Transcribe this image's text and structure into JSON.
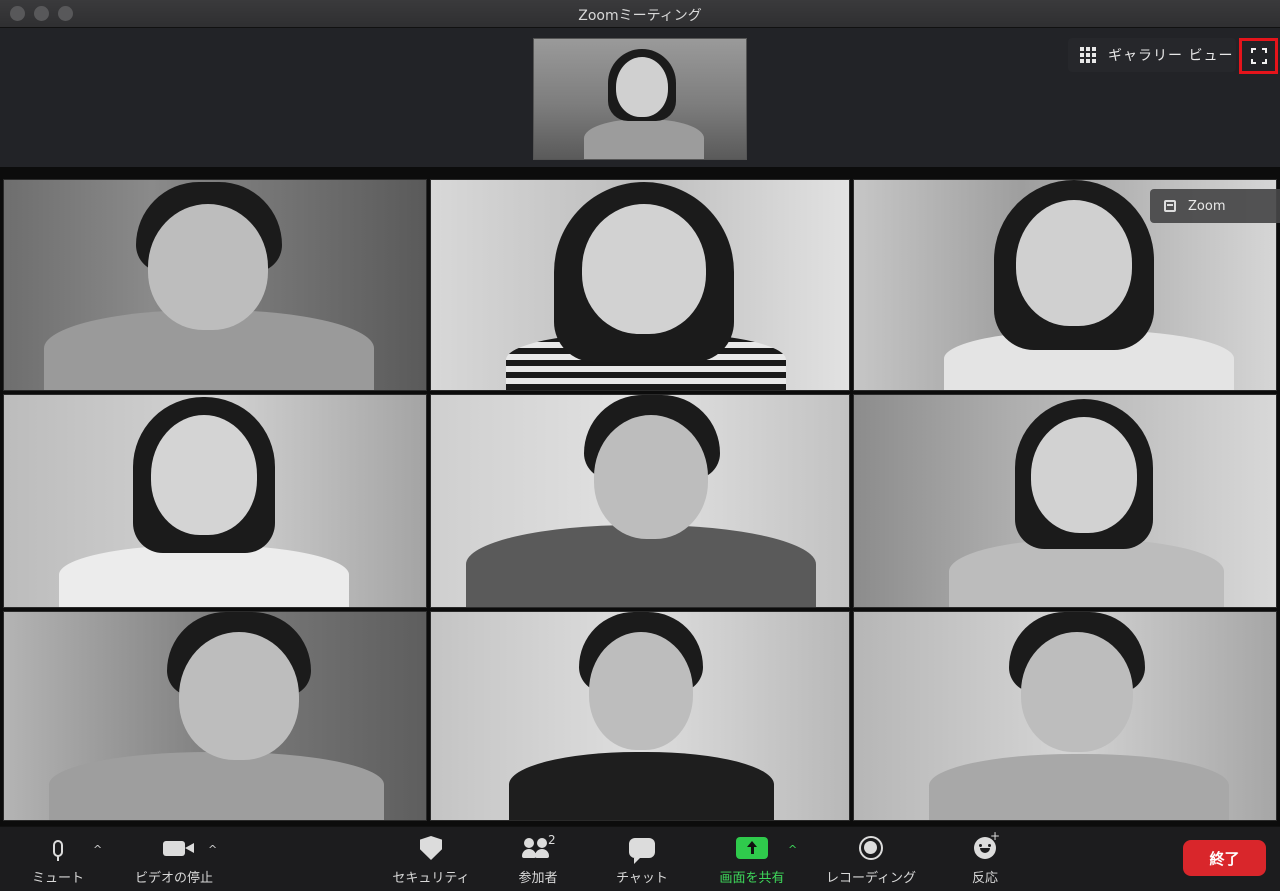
{
  "window": {
    "title": "Zoomミーティング"
  },
  "top": {
    "gallery_view_label": "ギャラリー ビュー",
    "gallery_icon": "grid-icon",
    "fullscreen_icon": "fullscreen-icon",
    "highlight_color": "#e5141b"
  },
  "overlay": {
    "zoom_label": "Zoom"
  },
  "tiles": [
    {
      "name": "participant-1"
    },
    {
      "name": "participant-2"
    },
    {
      "name": "participant-3"
    },
    {
      "name": "participant-4"
    },
    {
      "name": "participant-5"
    },
    {
      "name": "participant-6"
    },
    {
      "name": "participant-7"
    },
    {
      "name": "participant-8"
    },
    {
      "name": "participant-9"
    }
  ],
  "toolbar": {
    "mute_label": "ミュート",
    "video_label": "ビデオの停止",
    "security_label": "セキュリティ",
    "participants_label": "参加者",
    "participants_count": "2",
    "chat_label": "チャット",
    "share_label": "画面を共有",
    "record_label": "レコーディング",
    "reactions_label": "反応",
    "end_label": "終了",
    "caret": "^",
    "plus": "+",
    "share_color": "#2fca4c",
    "end_color": "#d9262b"
  }
}
